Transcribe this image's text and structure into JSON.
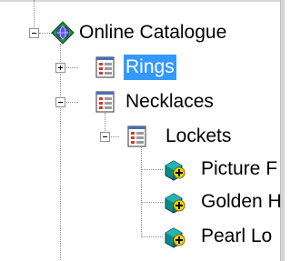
{
  "tree": {
    "catalog": {
      "label": "Online Catalogue",
      "icon": "catalogue-globe-icon",
      "expanded": true
    },
    "rings": {
      "label": "Rings",
      "icon": "category-form-icon",
      "expanded": false,
      "selected": true
    },
    "necklaces": {
      "label": "Necklaces",
      "icon": "category-form-icon",
      "expanded": true,
      "children": {
        "lockets": {
          "label": "Lockets",
          "icon": "category-form-icon",
          "expanded": true,
          "products": [
            {
              "label": "Picture F",
              "icon": "product-box-icon"
            },
            {
              "label": "Golden H",
              "icon": "product-box-icon"
            },
            {
              "label": "Pearl Lo",
              "icon": "product-box-icon"
            }
          ]
        }
      }
    }
  },
  "colors": {
    "selection": "#3399ff",
    "connector": "#8a8a8a",
    "product_box": "#0c8a8a",
    "product_badge": "#f0d600"
  }
}
